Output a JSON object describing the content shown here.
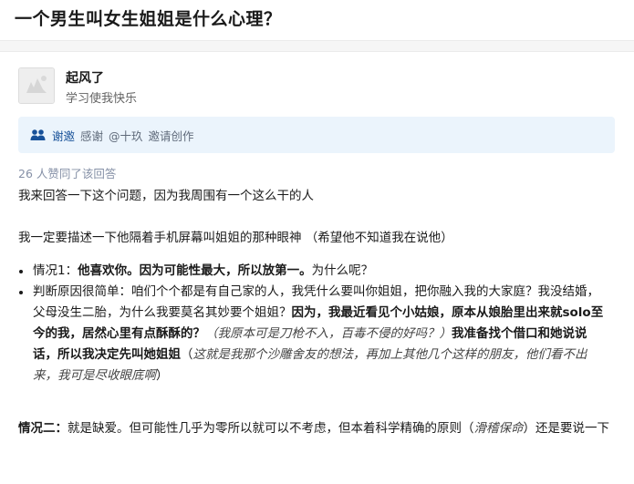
{
  "question": {
    "title": "一个男生叫女生姐姐是什么心理？"
  },
  "author": {
    "name": "起风了",
    "bio": "学习使我快乐"
  },
  "thanks": {
    "label": "谢邀",
    "text": "感谢",
    "mention": "@十玖",
    "invite": "邀请创作"
  },
  "likes": "26 人赞同了该回答",
  "answer": {
    "p1": "我来回答一下这个问题，因为我周围有一个这么干的人",
    "p2": "我一定要描述一下他隔着手机屏幕叫姐姐的那种眼神 （希望他不知道我在说他）",
    "b1": {
      "lead": "情况1：",
      "bold": "他喜欢你。因为可能性最大，所以放第一。",
      "tail": "为什么呢？"
    },
    "b2": {
      "s1": "判断原因很简单：咱们个个都是有自己家的人，我凭什么要叫你姐姐，把你融入我的大家庭？我没结婚，父母没生二胎，为什么我要莫名其妙要个姐姐？",
      "s2": "因为，我最近看见个小姑娘，原本从娘胎里出来就solo至今的我，居然心里有点酥酥的？",
      "s3": "（我原本可是刀枪不入，百毒不侵的好吗？）",
      "s4": "我准备找个借口和她说说话，所以我决定先叫她姐姐",
      "s5": "（",
      "s6": "这就是我那个沙雕舍友的想法，再加上其他几个这样的朋友，他们看不出来，我可是尽收眼底啊",
      "s7": "）"
    },
    "p3": {
      "lead": "情况二：",
      "s1": "就是缺爱。但可能性几乎为零所以就可以不考虑，但本着科学精确的原则（",
      "s2": "滑稽保命",
      "s3": "）还是要说一下"
    }
  },
  "colors": {
    "link": "#175199",
    "thanks_bg": "#ebf4fc",
    "meta": "#8590a6"
  }
}
